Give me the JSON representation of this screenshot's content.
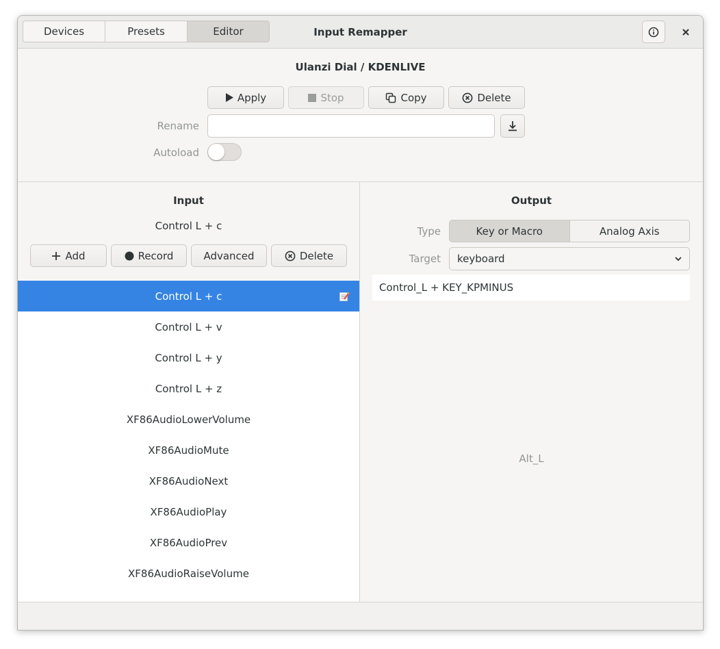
{
  "window": {
    "title": "Input Remapper"
  },
  "tabs": [
    {
      "label": "Devices"
    },
    {
      "label": "Presets"
    },
    {
      "label": "Editor"
    }
  ],
  "preset": {
    "device": "Ulanzi Dial",
    "separator": "/",
    "name": "KDENLIVE"
  },
  "actions": {
    "apply": "Apply",
    "stop": "Stop",
    "copy": "Copy",
    "delete": "Delete"
  },
  "rename": {
    "label": "Rename",
    "value": ""
  },
  "autoload": {
    "label": "Autoload",
    "enabled": false
  },
  "input": {
    "heading": "Input",
    "current": "Control L + c",
    "buttons": {
      "add": "Add",
      "record": "Record",
      "advanced": "Advanced",
      "delete": "Delete"
    },
    "items": [
      {
        "label": "Control L + c",
        "selected": true
      },
      {
        "label": "Control L + v"
      },
      {
        "label": "Control L + y"
      },
      {
        "label": "Control L + z"
      },
      {
        "label": "XF86AudioLowerVolume"
      },
      {
        "label": "XF86AudioMute"
      },
      {
        "label": "XF86AudioNext"
      },
      {
        "label": "XF86AudioPlay"
      },
      {
        "label": "XF86AudioPrev"
      },
      {
        "label": "XF86AudioRaiseVolume"
      }
    ]
  },
  "output": {
    "heading": "Output",
    "type_label": "Type",
    "type_options": [
      "Key or Macro",
      "Analog Axis"
    ],
    "type_selected": "Key or Macro",
    "target_label": "Target",
    "target_value": "keyboard",
    "text": "Control_L + KEY_KPMINUS",
    "hint": "Alt_L"
  },
  "colors": {
    "selection": "#3584e4",
    "background": "#f6f5f4"
  }
}
